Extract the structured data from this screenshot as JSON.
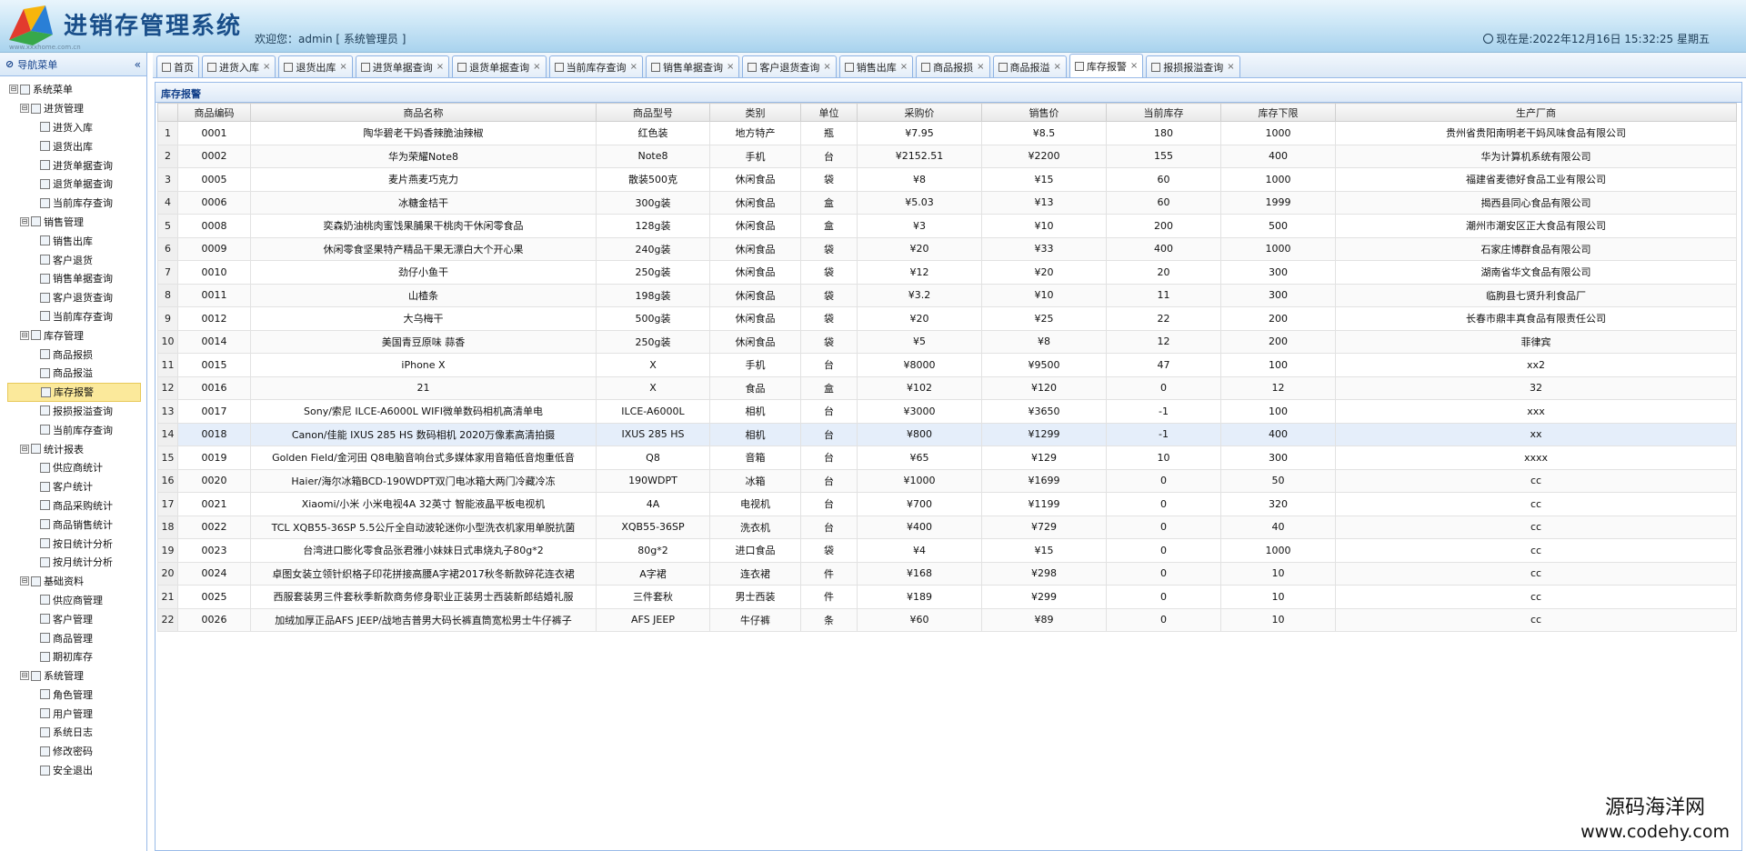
{
  "header": {
    "app_title": "进销存管理系统",
    "logo_sub": "www.xxxhome.com.cn",
    "welcome": "欢迎您：admin [ 系统管理员 ]",
    "clock": "现在是:2022年12月16日 15:32:25 星期五"
  },
  "sidebar": {
    "title": "导航菜单",
    "collapse_label": "«",
    "items": [
      {
        "level": 1,
        "label": "系统菜单",
        "exp": "⊟"
      },
      {
        "level": 2,
        "label": "进货管理",
        "exp": "⊟"
      },
      {
        "level": 3,
        "label": "进货入库"
      },
      {
        "level": 3,
        "label": "退货出库"
      },
      {
        "level": 3,
        "label": "进货单据查询"
      },
      {
        "level": 3,
        "label": "退货单据查询"
      },
      {
        "level": 3,
        "label": "当前库存查询"
      },
      {
        "level": 2,
        "label": "销售管理",
        "exp": "⊟"
      },
      {
        "level": 3,
        "label": "销售出库"
      },
      {
        "level": 3,
        "label": "客户退货"
      },
      {
        "level": 3,
        "label": "销售单据查询"
      },
      {
        "level": 3,
        "label": "客户退货查询"
      },
      {
        "level": 3,
        "label": "当前库存查询"
      },
      {
        "level": 2,
        "label": "库存管理",
        "exp": "⊟"
      },
      {
        "level": 3,
        "label": "商品报损"
      },
      {
        "level": 3,
        "label": "商品报溢"
      },
      {
        "level": 3,
        "label": "库存报警",
        "active": true
      },
      {
        "level": 3,
        "label": "报损报溢查询"
      },
      {
        "level": 3,
        "label": "当前库存查询"
      },
      {
        "level": 2,
        "label": "统计报表",
        "exp": "⊟"
      },
      {
        "level": 3,
        "label": "供应商统计"
      },
      {
        "level": 3,
        "label": "客户统计"
      },
      {
        "level": 3,
        "label": "商品采购统计"
      },
      {
        "level": 3,
        "label": "商品销售统计"
      },
      {
        "level": 3,
        "label": "按日统计分析"
      },
      {
        "level": 3,
        "label": "按月统计分析"
      },
      {
        "level": 2,
        "label": "基础资料",
        "exp": "⊟"
      },
      {
        "level": 3,
        "label": "供应商管理"
      },
      {
        "level": 3,
        "label": "客户管理"
      },
      {
        "level": 3,
        "label": "商品管理"
      },
      {
        "level": 3,
        "label": "期初库存"
      },
      {
        "level": 2,
        "label": "系统管理",
        "exp": "⊟"
      },
      {
        "level": 3,
        "label": "角色管理"
      },
      {
        "level": 3,
        "label": "用户管理"
      },
      {
        "level": 3,
        "label": "系统日志"
      },
      {
        "level": 3,
        "label": "修改密码"
      },
      {
        "level": 3,
        "label": "安全退出"
      }
    ]
  },
  "tabs": [
    {
      "label": "首页",
      "closable": false
    },
    {
      "label": "进货入库",
      "closable": true
    },
    {
      "label": "退货出库",
      "closable": true
    },
    {
      "label": "进货单据查询",
      "closable": true
    },
    {
      "label": "退货单据查询",
      "closable": true
    },
    {
      "label": "当前库存查询",
      "closable": true
    },
    {
      "label": "销售单据查询",
      "closable": true
    },
    {
      "label": "客户退货查询",
      "closable": true
    },
    {
      "label": "销售出库",
      "closable": true
    },
    {
      "label": "商品报损",
      "closable": true
    },
    {
      "label": "商品报溢",
      "closable": true
    },
    {
      "label": "库存报警",
      "closable": true,
      "active": true
    },
    {
      "label": "报损报溢查询",
      "closable": true
    }
  ],
  "tab_close": "×",
  "panel": {
    "title": "库存报警",
    "columns": [
      "",
      "商品编码",
      "商品名称",
      "商品型号",
      "类别",
      "单位",
      "采购价",
      "销售价",
      "当前库存",
      "库存下限",
      "生产厂商"
    ],
    "rows": [
      [
        "1",
        "0001",
        "陶华碧老干妈香辣脆油辣椒",
        "红色装",
        "地方特产",
        "瓶",
        "¥7.95",
        "¥8.5",
        "180",
        "1000",
        "贵州省贵阳南明老干妈风味食品有限公司"
      ],
      [
        "2",
        "0002",
        "华为荣耀Note8",
        "Note8",
        "手机",
        "台",
        "¥2152.51",
        "¥2200",
        "155",
        "400",
        "华为计算机系统有限公司"
      ],
      [
        "3",
        "0005",
        "麦片燕麦巧克力",
        "散装500克",
        "休闲食品",
        "袋",
        "¥8",
        "¥15",
        "60",
        "1000",
        "福建省麦德好食品工业有限公司"
      ],
      [
        "4",
        "0006",
        "冰糖金桔干",
        "300g装",
        "休闲食品",
        "盒",
        "¥5.03",
        "¥13",
        "60",
        "1999",
        "揭西县同心食品有限公司"
      ],
      [
        "5",
        "0008",
        "奕森奶油桃肉蜜饯果脯果干桃肉干休闲零食品",
        "128g装",
        "休闲食品",
        "盒",
        "¥3",
        "¥10",
        "200",
        "500",
        "潮州市潮安区正大食品有限公司"
      ],
      [
        "6",
        "0009",
        "休闲零食坚果特产精品干果无漂白大个开心果",
        "240g装",
        "休闲食品",
        "袋",
        "¥20",
        "¥33",
        "400",
        "1000",
        "石家庄博群食品有限公司"
      ],
      [
        "7",
        "0010",
        "劲仔小鱼干",
        "250g装",
        "休闲食品",
        "袋",
        "¥12",
        "¥20",
        "20",
        "300",
        "湖南省华文食品有限公司"
      ],
      [
        "8",
        "0011",
        "山楂条",
        "198g装",
        "休闲食品",
        "袋",
        "¥3.2",
        "¥10",
        "11",
        "300",
        "临朐县七贤升利食品厂"
      ],
      [
        "9",
        "0012",
        "大乌梅干",
        "500g装",
        "休闲食品",
        "袋",
        "¥20",
        "¥25",
        "22",
        "200",
        "长春市鼎丰真食品有限责任公司"
      ],
      [
        "10",
        "0014",
        "美国青豆原味 蒜香",
        "250g装",
        "休闲食品",
        "袋",
        "¥5",
        "¥8",
        "12",
        "200",
        "菲律宾"
      ],
      [
        "11",
        "0015",
        "iPhone X",
        "X",
        "手机",
        "台",
        "¥8000",
        "¥9500",
        "47",
        "100",
        "xx2"
      ],
      [
        "12",
        "0016",
        "21",
        "X",
        "食品",
        "盒",
        "¥102",
        "¥120",
        "0",
        "12",
        "32"
      ],
      [
        "13",
        "0017",
        "Sony/索尼 ILCE-A6000L WIFI微单数码相机高清单电",
        "ILCE-A6000L",
        "相机",
        "台",
        "¥3000",
        "¥3650",
        "-1",
        "100",
        "xxx"
      ],
      [
        "14",
        "0018",
        "Canon/佳能 IXUS 285 HS 数码相机 2020万像素高清拍摄",
        "IXUS 285 HS",
        "相机",
        "台",
        "¥800",
        "¥1299",
        "-1",
        "400",
        "xx"
      ],
      [
        "15",
        "0019",
        "Golden Field/金河田 Q8电脑音响台式多媒体家用音箱低音炮重低音",
        "Q8",
        "音箱",
        "台",
        "¥65",
        "¥129",
        "10",
        "300",
        "xxxx"
      ],
      [
        "16",
        "0020",
        "Haier/海尔冰箱BCD-190WDPT双门电冰箱大两门冷藏冷冻",
        "190WDPT",
        "冰箱",
        "台",
        "¥1000",
        "¥1699",
        "0",
        "50",
        "cc"
      ],
      [
        "17",
        "0021",
        "Xiaomi/小米 小米电视4A 32英寸 智能液晶平板电视机",
        "4A",
        "电视机",
        "台",
        "¥700",
        "¥1199",
        "0",
        "320",
        "cc"
      ],
      [
        "18",
        "0022",
        "TCL XQB55-36SP 5.5公斤全自动波轮迷你小型洗衣机家用单脱抗菌",
        "XQB55-36SP",
        "洗衣机",
        "台",
        "¥400",
        "¥729",
        "0",
        "40",
        "cc"
      ],
      [
        "19",
        "0023",
        "台湾进口膨化零食品张君雅小妹妹日式串烧丸子80g*2",
        "80g*2",
        "进口食品",
        "袋",
        "¥4",
        "¥15",
        "0",
        "1000",
        "cc"
      ],
      [
        "20",
        "0024",
        "卓图女装立领针织格子印花拼接高腰A字裙2017秋冬新款碎花连衣裙",
        "A字裙",
        "连衣裙",
        "件",
        "¥168",
        "¥298",
        "0",
        "10",
        "cc"
      ],
      [
        "21",
        "0025",
        "西服套装男三件套秋季新款商务修身职业正装男士西装新郎结婚礼服",
        "三件套秋",
        "男士西装",
        "件",
        "¥189",
        "¥299",
        "0",
        "10",
        "cc"
      ],
      [
        "22",
        "0026",
        "加绒加厚正品AFS JEEP/战地吉普男大码长裤直筒宽松男士牛仔裤子",
        "AFS JEEP",
        "牛仔裤",
        "条",
        "¥60",
        "¥89",
        "0",
        "10",
        "cc"
      ]
    ],
    "selected_row": 14
  },
  "watermark": {
    "line1": "源码海洋网",
    "line2": "www.codehy.com"
  }
}
